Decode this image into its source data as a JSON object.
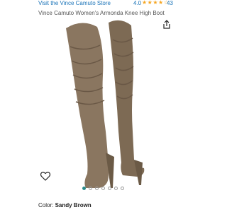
{
  "header": {
    "store_link": "Visit the Vince Camuto Store",
    "rating_value": "4.0",
    "stars": "★★★★☆",
    "review_count": "43"
  },
  "product": {
    "title": "Vince Camuto Women's Armonda Knee High Boot"
  },
  "gallery": {
    "image_count": 7,
    "active_index": 0
  },
  "color": {
    "label": "Color:",
    "value": "Sandy Brown"
  },
  "colors": {
    "link": "#1a73b8",
    "star": "#f5a623",
    "boot": "#7d6a54",
    "active_dot": "#2a8a8a"
  },
  "icons": {
    "share": "share-icon",
    "favorite": "heart-icon"
  }
}
